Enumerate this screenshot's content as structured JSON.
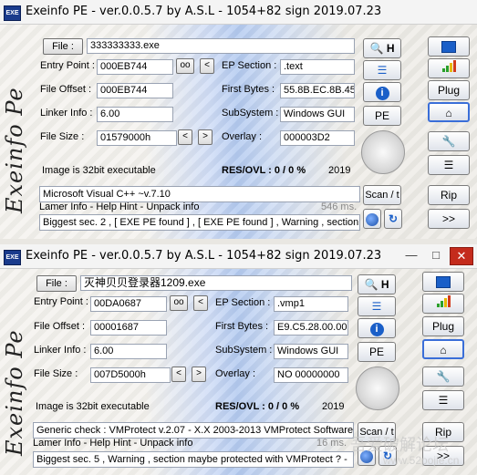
{
  "colors": {
    "close": "#c42b1c",
    "accent_blue": "#1a5fc8",
    "signal_green": "#2aa02a",
    "signal_red": "#d23a1a"
  },
  "top": {
    "title": "Exeinfo PE - ver.0.0.5.7  by A.S.L -  1054+82 sign  2019.07.23",
    "side_logo": "Exeinfo Pe",
    "file_label": "File :",
    "file_value": "333333333.exe",
    "entry_point_label": "Entry Point :",
    "entry_point_value": "000EB744",
    "oo_label": "oo",
    "arrow_label": "<",
    "ep_section_label": "EP Section :",
    "ep_section_value": ".text",
    "file_offset_label": "File Offset :",
    "file_offset_value": "000EB744",
    "first_bytes_label": "First Bytes :",
    "first_bytes_value": "55.8B.EC.8B.45",
    "linker_info_label": "Linker Info :",
    "linker_info_value": "6.00",
    "subsystem_label": "SubSystem :",
    "subsystem_value": "Windows GUI",
    "file_size_label": "File Size :",
    "file_size_value": "01579000h",
    "overlay_label": "Overlay :",
    "overlay_value": "000003D2",
    "image_bits": "Image is 32bit executable",
    "res_ovl": "RES/OVL : 0 / 0 %",
    "year": "2019",
    "detect": "Microsoft Visual C++ ~v.7.10",
    "hint": "Lamer Info - Help Hint - Unpack info",
    "hint_ms": "546 ms.",
    "summary": "Biggest sec. 2 , [ EXE PE found ] , [ EXE PE found ] , Warning , section",
    "btn_h": "H",
    "btn_pe": "PE",
    "btn_scan": "Scan / t",
    "btn_plug": "Plug",
    "btn_rip": "Rip",
    "btn_next": ">>"
  },
  "bottom": {
    "title": "Exeinfo PE - ver.0.0.5.7  by A.S.L -  1054+82 sign  2019.07.23",
    "side_logo": "Exeinfo Pe",
    "file_label": "File :",
    "file_value": "灭神贝贝登录器1209.exe",
    "entry_point_label": "Entry Point :",
    "entry_point_value": "00DA0687",
    "oo_label": "oo",
    "arrow_label": "<",
    "ep_section_label": "EP Section :",
    "ep_section_value": ".vmp1",
    "file_offset_label": "File Offset :",
    "file_offset_value": "00001687",
    "first_bytes_label": "First Bytes :",
    "first_bytes_value": "E9.C5.28.00.00",
    "linker_info_label": "Linker Info :",
    "linker_info_value": "6.00",
    "subsystem_label": "SubSystem :",
    "subsystem_value": "Windows GUI",
    "file_size_label": "File Size :",
    "file_size_value": "007D5000h",
    "overlay_label": "Overlay :",
    "overlay_value": "NO  00000000",
    "image_bits": "Image is 32bit executable",
    "res_ovl": "RES/OVL : 0 / 0 %",
    "year": "2019",
    "detect": "Generic check : VMProtect v.2.07 - X.X  2003-2013 VMProtect Software",
    "hint": "Lamer Info - Help Hint - Unpack info",
    "hint_ms": "16 ms.",
    "summary": "Biggest sec. 5 , Warning , section maybe protected with VMProtect ? -",
    "btn_h": "H",
    "btn_pe": "PE",
    "btn_scan": "Scan / t",
    "btn_plug": "Plug",
    "btn_rip": "Rip",
    "btn_next": ">>"
  },
  "watermark": {
    "text": "吾爱破解论坛",
    "url": "www.52pojie.cn"
  }
}
